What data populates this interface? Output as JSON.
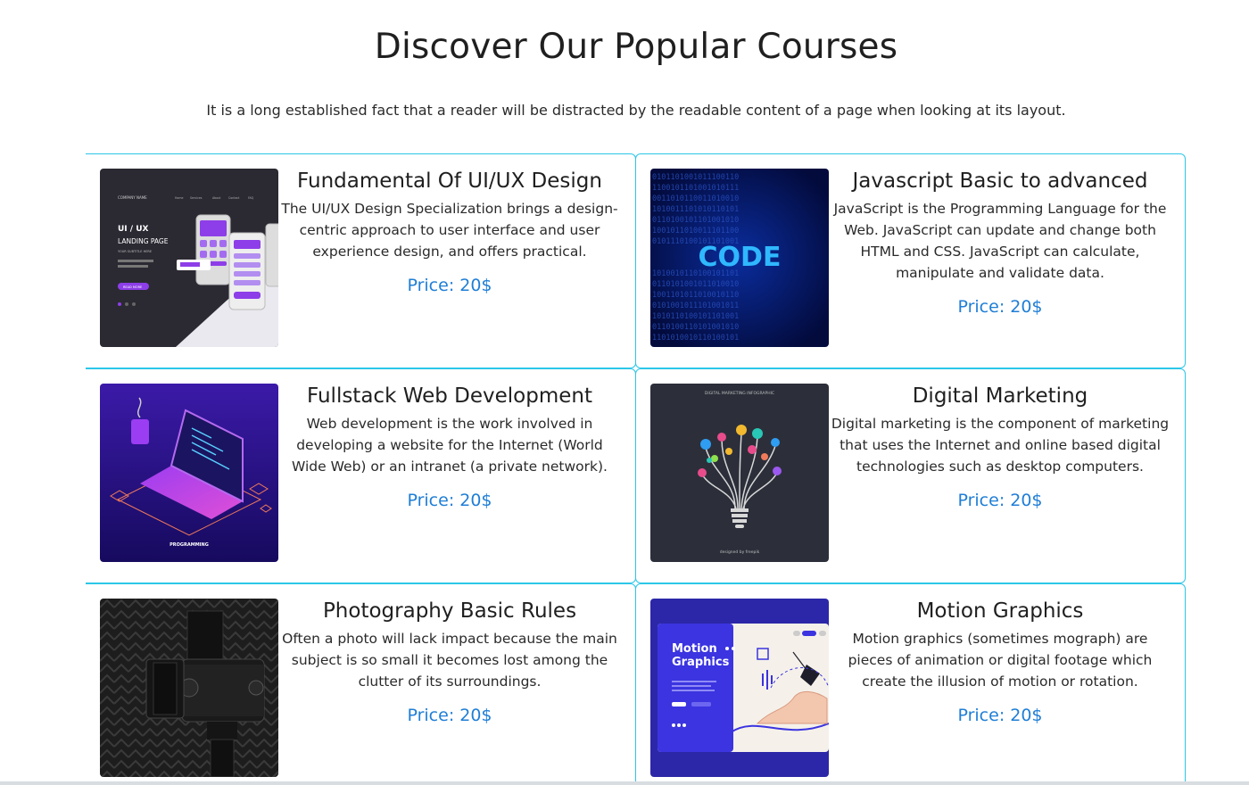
{
  "section": {
    "title": "Discover Our Popular Courses",
    "subtitle": "It is a long established fact that a reader will be distracted by the readable content of a page when looking at its layout."
  },
  "courses": [
    {
      "title": "Fundamental Of UI/UX Design",
      "description": "The UI/UX Design Specialization brings a design-centric approach to user interface and user experience design, and offers practical.",
      "price": "Price: 20$",
      "image_text": [
        "COMPANY NAME",
        "Home",
        "Services",
        "About",
        "Contact",
        "FAQ",
        "UI / UX",
        "LANDING PAGE",
        "YOUR SUBTITLE HERE",
        "READ MORE"
      ]
    },
    {
      "title": "Javascript Basic to advanced",
      "description": "JavaScript is the Programming Language for the Web. JavaScript can update and change both HTML and CSS. JavaScript can calculate, manipulate and validate data.",
      "price": "Price: 20$",
      "image_text": [
        "CODE"
      ]
    },
    {
      "title": "Fullstack Web Development",
      "description": "Web development is the work involved in developing a website for the Internet (World Wide Web) or an intranet (a private network).",
      "price": "Price: 20$",
      "image_text": [
        "PROGRAMMING"
      ]
    },
    {
      "title": "Digital Marketing",
      "description": "Digital marketing is the component of marketing that uses the Internet and online based digital technologies such as desktop computers.",
      "price": "Price: 20$",
      "image_text": [
        "DIGITAL MARKETING INFOGRAPHIC",
        "designed by freepik"
      ]
    },
    {
      "title": "Photography Basic Rules",
      "description": "Often a photo will lack impact because the main subject is so small it becomes lost among the clutter of its surroundings.",
      "price": "Price: 20$",
      "image_text": []
    },
    {
      "title": "Motion Graphics",
      "description": "Motion graphics (sometimes mograph) are pieces of animation or digital footage which create the illusion of motion or rotation.",
      "price": "Price: 20$",
      "image_text": [
        "Motion",
        "Graphics"
      ]
    }
  ],
  "colors": {
    "card_border": "#2cc6e8",
    "price": "#1f7ed6",
    "heading": "#1f1f1f"
  }
}
